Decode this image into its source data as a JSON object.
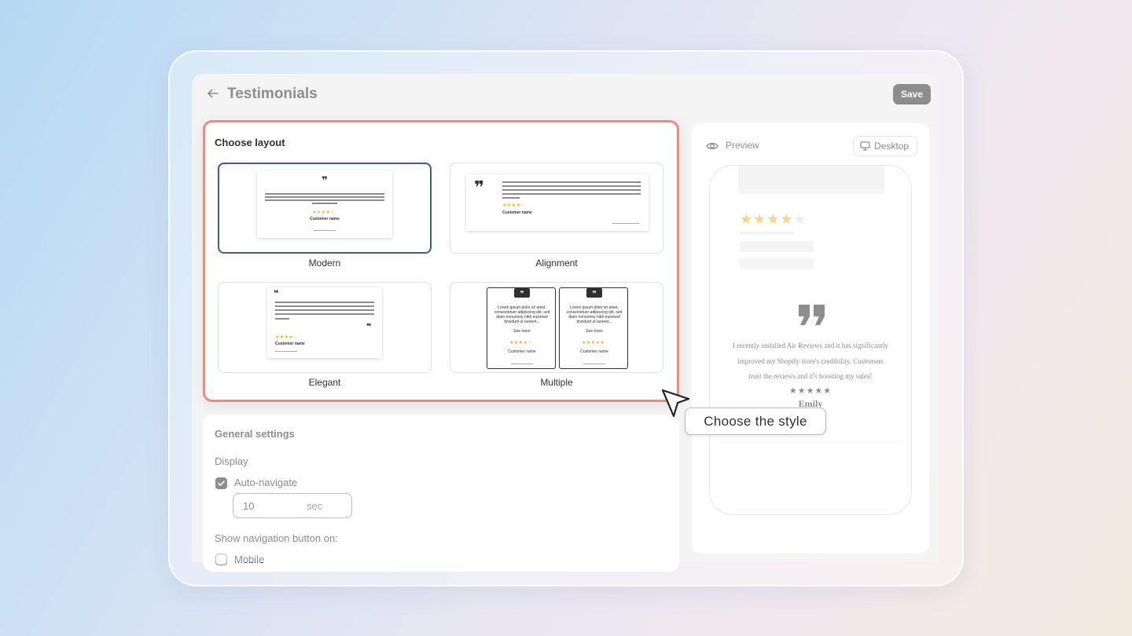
{
  "header": {
    "title": "Testimonials",
    "save_label": "Save"
  },
  "layout": {
    "title": "Choose layout",
    "selected": "Modern",
    "options": [
      {
        "label": "Modern"
      },
      {
        "label": "Alignment"
      },
      {
        "label": "Elegant"
      },
      {
        "label": "Multiple"
      }
    ],
    "sample": {
      "stars": "★★★★☆",
      "customer": "Customer name",
      "lorem": "Lorem ipsum dolor sit amet, consectetuer adipiscing elit, sed diam nonummy nibh euismod tincidunt ut laoreet...",
      "see_more": "See more"
    }
  },
  "settings": {
    "title": "General settings",
    "display_label": "Display",
    "auto_navigate_label": "Auto-navigate",
    "auto_navigate_checked": true,
    "interval_value": "10",
    "interval_unit": "sec",
    "nav_button_label": "Show navigation button on:",
    "mobile_label": "Mobile",
    "mobile_checked": false
  },
  "preview": {
    "label": "Preview",
    "device_label": "Desktop",
    "stars": "★★★★★",
    "rating_stars": "★★★★★",
    "quote": "I recently installed Air Reviews and it has significantly improved my Shopify store's credibility. Customers trust the reviews and it's boosting my sales!",
    "author": "Emily"
  },
  "tooltip": {
    "text": "Choose the style"
  },
  "colors": {
    "highlight_border": "#ef8b7d",
    "selected_border": "#3a5ba9",
    "star": "#e8b923",
    "button_dark": "#303030"
  }
}
